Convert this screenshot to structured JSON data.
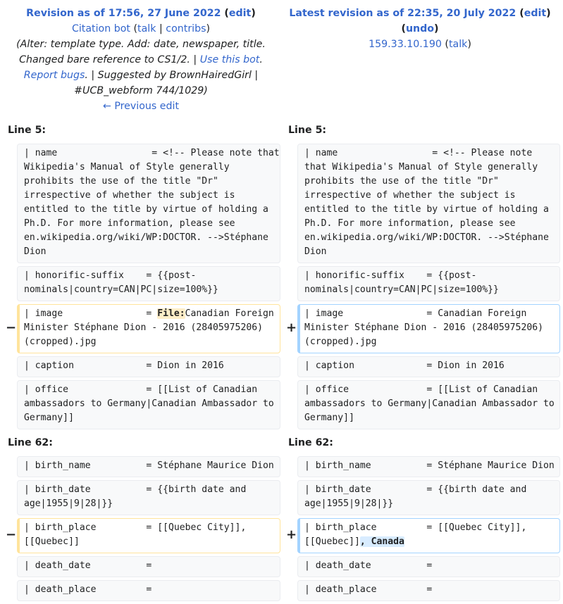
{
  "left_header": {
    "title": "Revision as of 17:56, 27 June 2022",
    "edit": "edit",
    "user": "Citation bot",
    "talk": "talk",
    "contribs": "contribs",
    "summary_part1": "(Alter: template type. Add: date, newspaper, title. Changed bare reference to CS1/2. | ",
    "use_bot": "Use this bot",
    "summary_part2": ". ",
    "report_bugs": "Report bugs",
    "summary_part3": ". | Suggested by BrownHairedGirl | #UCB_webform 744/1029)",
    "prev_edit": "← Previous edit"
  },
  "right_header": {
    "title": "Latest revision as of 22:35, 20 July 2022",
    "edit": "edit",
    "undo": "undo",
    "user": "159.33.10.190",
    "talk": "talk"
  },
  "sections": [
    {
      "label_left": "Line 5:",
      "label_right": "Line 5:"
    },
    {
      "label_left": "Line 62:",
      "label_right": "Line 62:"
    }
  ],
  "markers": {
    "removed": "−",
    "added": "+"
  },
  "rows": {
    "name": "| name                 = <!-- Please note that Wikipedia's Manual of Style generally prohibits the use of the title \"Dr\" irrespective of whether the subject is entitled to the title by virtue of holding a Ph.D. For more information, please see en.wikipedia.org/wiki/WP:DOCTOR. -->Stéphane Dion",
    "honorific": "| honorific-suffix    = {{post-nominals|country=CAN|PC|size=100%}}",
    "image_left_pre": "| image               = ",
    "image_left_hl": "File:",
    "image_left_post": "Canadian Foreign Minister Stéphane Dion - 2016 (28405975206) (cropped).jpg",
    "image_right": "| image               = Canadian Foreign Minister Stéphane Dion - 2016 (28405975206) (cropped).jpg",
    "caption": "| caption             = Dion in 2016",
    "office": "| office              = [[List of Canadian ambassadors to Germany|Canadian Ambassador to Germany]]",
    "birth_name": "| birth_name          = Stéphane Maurice Dion",
    "birth_date": "| birth_date          = {{birth date and age|1955|9|28|}}",
    "birth_place_left": "| birth_place         = [[Quebec City]], [[Quebec]]",
    "birth_place_right_pre": "| birth_place         = [[Quebec City]], [[Quebec]]",
    "birth_place_right_hl": ", Canada",
    "death_date": "| death_date          =",
    "death_place": "| death_place         ="
  }
}
